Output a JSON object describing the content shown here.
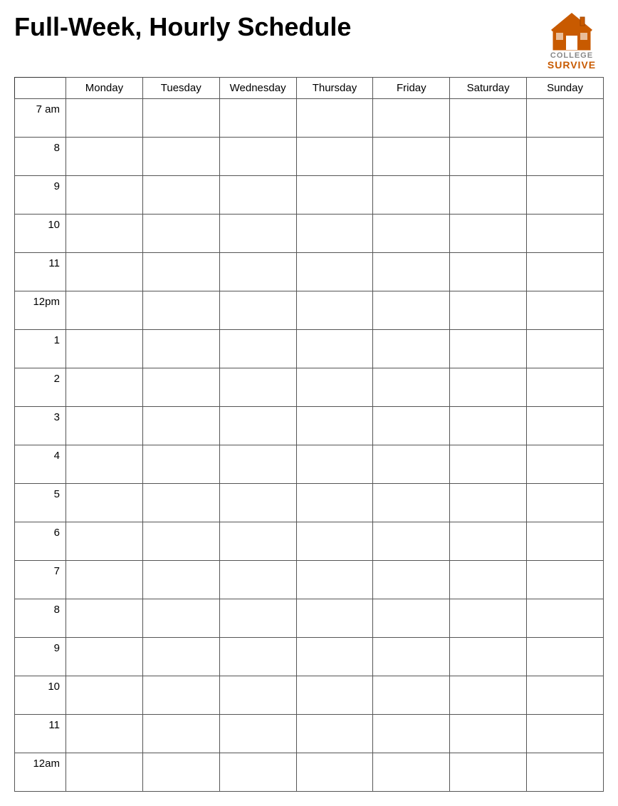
{
  "header": {
    "title": "Full-Week, Hourly Schedule",
    "logo": {
      "college": "COLLEGE",
      "survive": "SURVIVE"
    }
  },
  "columns": {
    "time_header": "",
    "days": [
      "Monday",
      "Tuesday",
      "Wednesday",
      "Thursday",
      "Friday",
      "Saturday",
      "Sunday"
    ]
  },
  "rows": [
    "7 am",
    "8",
    "9",
    "10",
    "11",
    "12pm",
    "1",
    "2",
    "3",
    "4",
    "5",
    "6",
    "7",
    "8",
    "9",
    "10",
    "11",
    "12am"
  ]
}
